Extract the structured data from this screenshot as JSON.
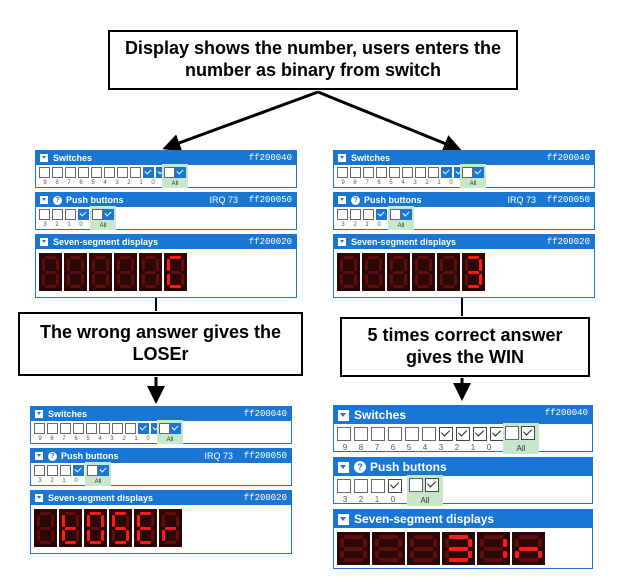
{
  "callouts": {
    "top": "Display shows the number, users enters the number as binary from switch",
    "bottom_left": "The wrong answer gives the LOSEr",
    "bottom_right": "5 times correct answer gives the WIN"
  },
  "panel_labels": {
    "switches": "Switches",
    "push_buttons": "Push buttons",
    "seven_segment": "Seven-segment displays",
    "all": "All",
    "irq": "IRQ 73",
    "switches_addr": "ff200040",
    "push_addr": "ff200050",
    "seg_addr": "ff200020",
    "help_symbol": "?"
  },
  "switch_numbers": [
    "9",
    "8",
    "7",
    "6",
    "5",
    "4",
    "3",
    "2",
    "1",
    "0"
  ],
  "button_numbers": [
    "3",
    "2",
    "1",
    "0"
  ],
  "snapshots": [
    {
      "id": "top-left",
      "switches_on": [
        1,
        0
      ],
      "switches_all": true,
      "buttons_on": [
        0
      ],
      "buttons_all": true,
      "display": [
        "",
        "",
        "",
        "",
        "",
        "C"
      ]
    },
    {
      "id": "top-right",
      "switches_on": [
        1,
        0
      ],
      "switches_all": true,
      "buttons_on": [
        0
      ],
      "buttons_all": true,
      "display": [
        "",
        "",
        "",
        "",
        "",
        "3"
      ]
    },
    {
      "id": "bottom-left",
      "switches_on": [
        1,
        0
      ],
      "switches_all": true,
      "buttons_on": [
        0
      ],
      "buttons_all": true,
      "display": [
        "",
        "t",
        "O",
        "S",
        "E",
        "r"
      ]
    },
    {
      "id": "bottom-right",
      "switches_on": [
        3,
        2,
        1,
        0
      ],
      "switches_all": true,
      "buttons_on": [
        0
      ],
      "buttons_all": true,
      "display": [
        "",
        "",
        "",
        "3",
        "1",
        "n"
      ]
    }
  ],
  "colors": {
    "accent": "#1976d2",
    "segment_on": "#ff1a1a",
    "segment_off": "#5e0d0d",
    "all_background": "#c8e6c9"
  }
}
